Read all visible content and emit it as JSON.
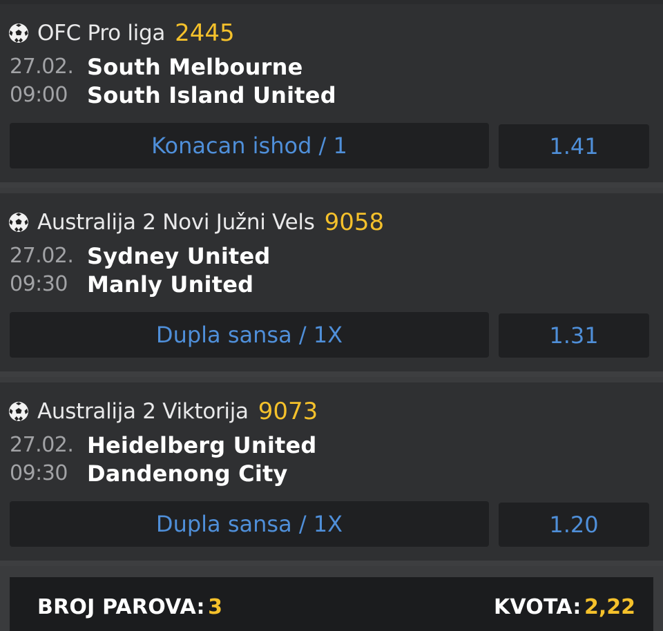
{
  "colors": {
    "accent_yellow": "#f5c12b",
    "link_blue": "#4f8fd9",
    "card_bg": "#2f3032",
    "button_bg": "#1f2022"
  },
  "matches": [
    {
      "icon": "soccer-ball-icon",
      "league": "OFC Pro liga",
      "code": "2445",
      "date": "27.02.",
      "time": "09:00",
      "home": "South Melbourne",
      "away": "South Island United",
      "bet": "Konacan ishod / 1",
      "odds": "1.41"
    },
    {
      "icon": "soccer-ball-icon",
      "league": "Australija 2 Novi Južni Vels",
      "code": "9058",
      "date": "27.02.",
      "time": "09:30",
      "home": "Sydney United",
      "away": "Manly United",
      "bet": "Dupla sansa / 1X",
      "odds": "1.31"
    },
    {
      "icon": "soccer-ball-icon",
      "league": "Australija 2 Viktorija",
      "code": "9073",
      "date": "27.02.",
      "time": "09:30",
      "home": "Heidelberg United",
      "away": "Dandenong City",
      "bet": "Dupla sansa / 1X",
      "odds": "1.20"
    }
  ],
  "footer": {
    "pairs_label": "BROJ PAROVA:",
    "pairs_value": "3",
    "odds_label": "KVOTA:",
    "odds_value": "2,22"
  }
}
